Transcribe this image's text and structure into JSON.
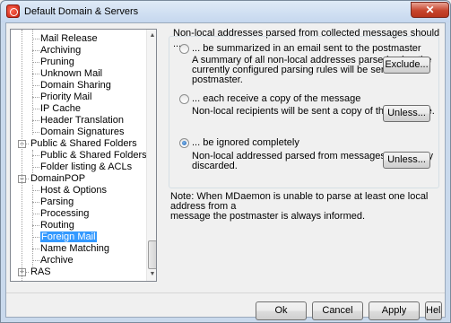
{
  "window": {
    "title": "Default Domain & Servers",
    "close_glyph": "✕"
  },
  "tree": {
    "items": [
      {
        "label": "Mail Release",
        "level": 1
      },
      {
        "label": "Archiving",
        "level": 1
      },
      {
        "label": "Pruning",
        "level": 1
      },
      {
        "label": "Unknown Mail",
        "level": 1
      },
      {
        "label": "Domain Sharing",
        "level": 1
      },
      {
        "label": "Priority Mail",
        "level": 1
      },
      {
        "label": "IP Cache",
        "level": 1
      },
      {
        "label": "Header Translation",
        "level": 1
      },
      {
        "label": "Domain Signatures",
        "level": 1
      },
      {
        "label": "Public & Shared Folders",
        "level": 0,
        "expander": "−"
      },
      {
        "label": "Public & Shared Folders",
        "level": 1
      },
      {
        "label": "Folder listing & ACLs",
        "level": 1
      },
      {
        "label": "DomainPOP",
        "level": 0,
        "expander": "−"
      },
      {
        "label": "Host & Options",
        "level": 1
      },
      {
        "label": "Parsing",
        "level": 1
      },
      {
        "label": "Processing",
        "level": 1
      },
      {
        "label": "Routing",
        "level": 1
      },
      {
        "label": "Foreign Mail",
        "level": 1,
        "selected": true
      },
      {
        "label": "Name Matching",
        "level": 1
      },
      {
        "label": "Archive",
        "level": 1
      },
      {
        "label": "RAS",
        "level": 0,
        "expander": "+"
      }
    ]
  },
  "panel": {
    "heading": "Non-local addresses parsed from collected messages should ...",
    "options": [
      {
        "label": "... be summarized in an email sent to the postmaster",
        "desc_lines": [
          "A summary of all non-local addresses parsed using the",
          "currently configured parsing rules will be sent to the",
          "postmaster."
        ],
        "button": "Exclude...",
        "checked": false
      },
      {
        "label": "... each receive a copy of the message",
        "desc_lines": [
          "Non-local recipients will be sent a copy of the message."
        ],
        "button": "Unless...",
        "checked": false
      },
      {
        "label": "... be ignored completely",
        "desc_lines": [
          "Non-local addressed parsed from messages are simply",
          "discarded."
        ],
        "button": "Unless...",
        "checked": true
      }
    ],
    "note_lines": [
      "Note:  When MDaemon is unable to parse at least one local address from a",
      "message the postmaster is always informed."
    ]
  },
  "footer": {
    "ok": "Ok",
    "cancel": "Cancel",
    "apply": "Apply",
    "help": "Help"
  }
}
